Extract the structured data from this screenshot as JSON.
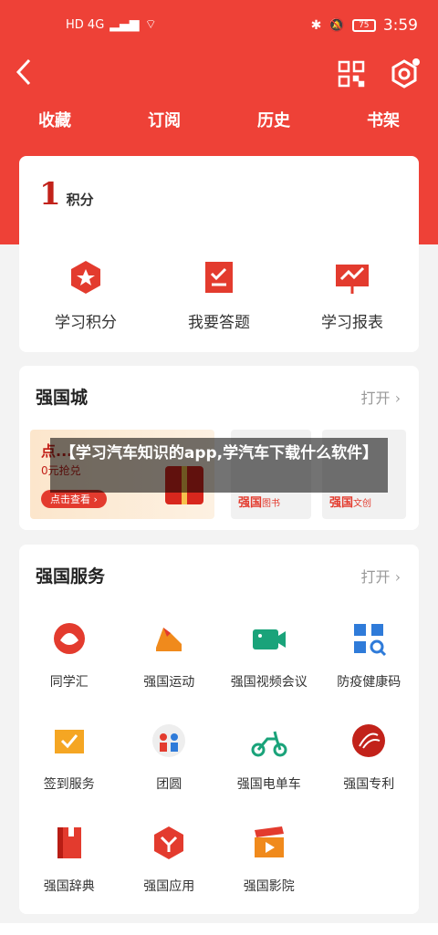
{
  "status_bar": {
    "network": "HD 4G",
    "time": "3:59",
    "battery": "75",
    "icons": [
      "signal-icon",
      "wifi-icon",
      "bluetooth-icon",
      "mute-icon",
      "battery-icon"
    ]
  },
  "header": {
    "back_icon": "back-arrow-icon",
    "qr_icon": "qr-code-icon",
    "settings_icon": "gear-icon"
  },
  "tabs": [
    {
      "label": "收藏"
    },
    {
      "label": "订阅"
    },
    {
      "label": "历史"
    },
    {
      "label": "书架"
    }
  ],
  "points_card": {
    "value": "1",
    "unit": "积分",
    "items": [
      {
        "label": "学习积分",
        "icon": "points-icon"
      },
      {
        "label": "我要答题",
        "icon": "quiz-icon"
      },
      {
        "label": "学习报表",
        "icon": "report-icon"
      }
    ]
  },
  "mall_card": {
    "title": "强国城",
    "more": "打开 ›",
    "promo": {
      "title": "点...",
      "subtitle": "0元抢兑",
      "button": "点击查看 ›"
    },
    "tiles": [
      {
        "brand": "强国",
        "sub": "图书"
      },
      {
        "brand": "强国",
        "sub": "文创"
      }
    ]
  },
  "overlay": {
    "text": "【学习汽车知识的app,学汽车下载什么软件】"
  },
  "services_card": {
    "title": "强国服务",
    "more": "打开 ›",
    "rows": [
      [
        {
          "label": "同学汇",
          "icon": "classmates-icon"
        },
        {
          "label": "强国运动",
          "icon": "sports-shoe-icon"
        },
        {
          "label": "强国视频会议",
          "icon": "video-camera-icon"
        },
        {
          "label": "防疫健康码",
          "icon": "health-code-icon"
        }
      ],
      [
        {
          "label": "签到服务",
          "icon": "checkin-icon"
        },
        {
          "label": "团圆",
          "icon": "reunion-icon"
        },
        {
          "label": "强国电单车",
          "icon": "ebike-icon"
        },
        {
          "label": "强国专利",
          "icon": "patent-icon"
        }
      ],
      [
        {
          "label": "强国辞典",
          "icon": "dictionary-icon"
        },
        {
          "label": "强国应用",
          "icon": "apps-icon"
        },
        {
          "label": "强国影院",
          "icon": "cinema-icon"
        }
      ]
    ]
  },
  "colors": {
    "brand_red": "#ee4137",
    "background": "#f3f3f3"
  }
}
